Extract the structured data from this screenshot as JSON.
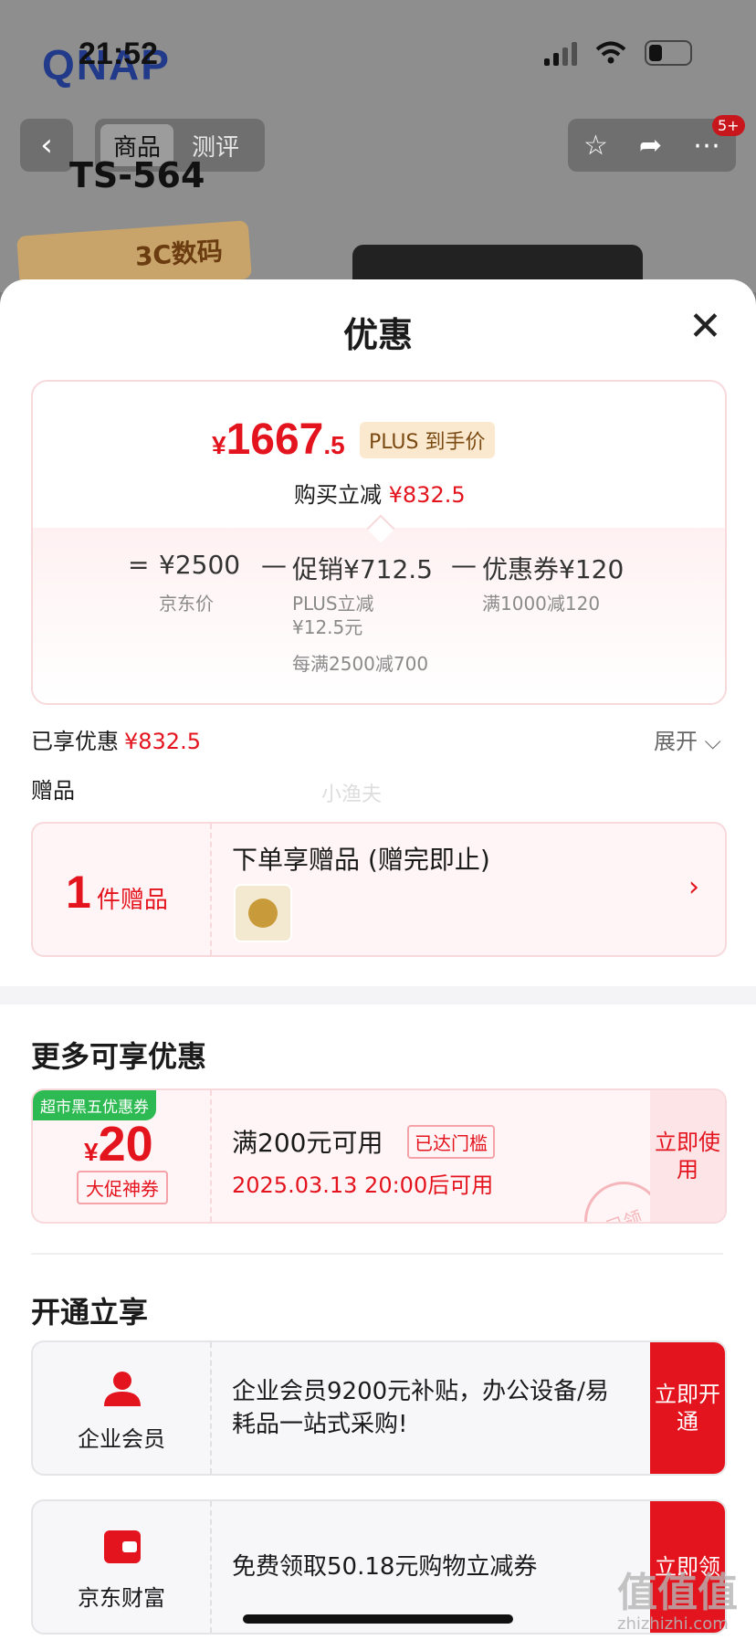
{
  "status_bar": {
    "time": "21:52",
    "logo": "QNAP"
  },
  "nav": {
    "back_icon": "‹",
    "tab_goods": "商品",
    "tab_review": "测评",
    "badge": "5+",
    "model": "TS-564",
    "category": "3C数码"
  },
  "sheet": {
    "title": "优惠",
    "close_icon": "✕",
    "price": {
      "currency": "¥",
      "integer": "1667",
      "decimal": ".5",
      "plus_tag": "PLUS 到手价",
      "buy_cut_label": "购买立减",
      "buy_cut_value": "¥832.5"
    },
    "formula": {
      "eq": "=",
      "jd_price": "¥2500",
      "jd_price_label": "京东价",
      "minus1": "—",
      "promo": "促销¥712.5",
      "promo_detail1": "PLUS立减",
      "promo_detail2": "¥12.5元",
      "promo_detail3": "每满2500减700",
      "minus2": "—",
      "coupon": "优惠券¥120",
      "coupon_detail": "满1000减120"
    },
    "enjoyed_label": "已享优惠",
    "enjoyed_value": "¥832.5",
    "expand": "展开 ⌵",
    "gift_section": "赠品",
    "watermark": "小渔夫",
    "gift": {
      "count": "1",
      "count_label": "件赠品",
      "title": "下单享赠品 (赠完即止)",
      "arrow": "›"
    },
    "more_title": "更多可享优惠",
    "coupon": {
      "tag": "超市黑五优惠券",
      "currency": "¥",
      "value": "20",
      "chip": "大促神券",
      "condition": "满200元可用",
      "reached": "已达门槛",
      "time": "2025.03.13 20:00后可用",
      "button": "立即使用",
      "stamp": "已领"
    },
    "open_title": "开通立享",
    "members": [
      {
        "name": "企业会员",
        "desc": "企业会员9200元补贴，办公设备/易耗品一站式采购!",
        "button": "立即开通"
      },
      {
        "name": "京东财富",
        "desc": "免费领取50.18元购物立减券",
        "button": "立即领"
      }
    ]
  },
  "site_watermark": {
    "mark": "值值值",
    "url": "zhizhizhi.com"
  },
  "colors": {
    "accent": "#e4141e",
    "green": "#2eba52",
    "plus_gold": "#fbe9cf"
  }
}
